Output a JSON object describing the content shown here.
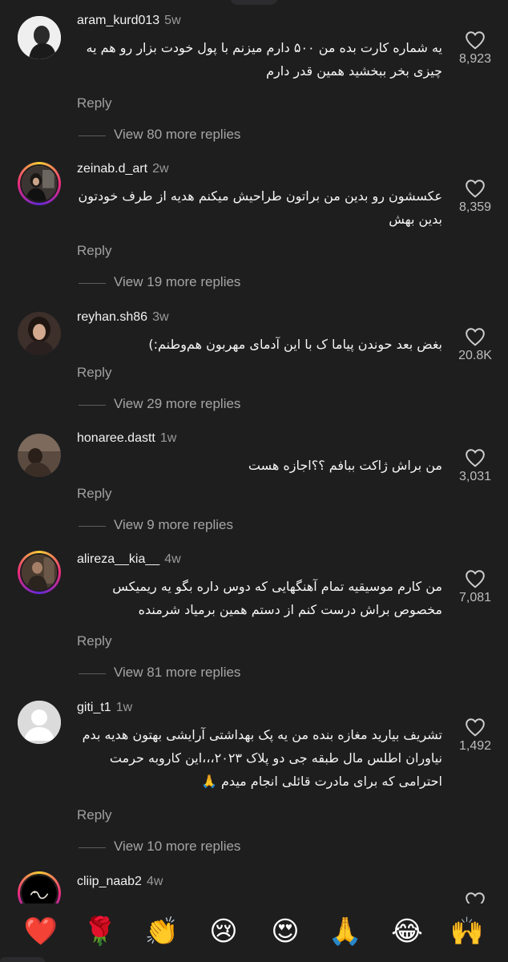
{
  "comments": [
    {
      "username": "aram_kurd013",
      "time": "5w",
      "text": "یه شماره کارت بده من ۵۰۰ دارم میزنم با پول خودت بزار رو هم یه چیزی بخر ببخشید همین قدر دارم",
      "likes": "8,923",
      "reply_label": "Reply",
      "view_more": "View 80 more replies"
    },
    {
      "username": "zeinab.d_art",
      "time": "2w",
      "text": "عکسشون رو بدین من براتون طراحیش میکنم هدیه از طرف خودتون بدین بهش",
      "likes": "8,359",
      "reply_label": "Reply",
      "view_more": "View 19 more replies"
    },
    {
      "username": "reyhan.sh86",
      "time": "3w",
      "text": "بغض بعد حوندن پیاما ک با این آدمای مهربون هم‌وطنم:)",
      "likes": "20.8K",
      "reply_label": "Reply",
      "view_more": "View 29 more replies"
    },
    {
      "username": "honaree.dastt",
      "time": "1w",
      "text": "من براش ژاکت ببافم ؟؟اجازه هست",
      "likes": "3,031",
      "reply_label": "Reply",
      "view_more": "View 9 more replies"
    },
    {
      "username": "alireza__kia__",
      "time": "4w",
      "text": "من کارم موسیقیه تمام آهنگهایی که دوس داره بگو یه ریمیکس مخصوص براش درست کنم از دستم همین برمیاد شرمنده",
      "likes": "7,081",
      "reply_label": "Reply",
      "view_more": "View 81 more replies"
    },
    {
      "username": "giti_t1",
      "time": "1w",
      "text": "تشریف بیارید مغازه بنده من یه پک بهداشتی آرایشی بهتون هدیه بدم نیاوران اطلس مال طبقه جی دو پلاک ۲۰۲۳،،،این کاروبه حرمت احترامی که برای مادرت قائلی انجام میدم 🙏",
      "likes": "1,492",
      "reply_label": "Reply",
      "view_more": "View 10 more replies"
    },
    {
      "username": "cliip_naab2",
      "time": "4w"
    }
  ],
  "reactions": [
    "❤️",
    "🌹",
    "👏",
    "😢",
    "😍",
    "🙏",
    "😂",
    "🙌"
  ],
  "icons": {
    "like": "heart-outline-icon"
  },
  "colors": {
    "background": "#1e1e1f",
    "text": "#f5f5f5",
    "muted": "#9a9a9a",
    "story_ring": [
      "#f9ce34",
      "#ee2a7b",
      "#6228d7"
    ]
  }
}
